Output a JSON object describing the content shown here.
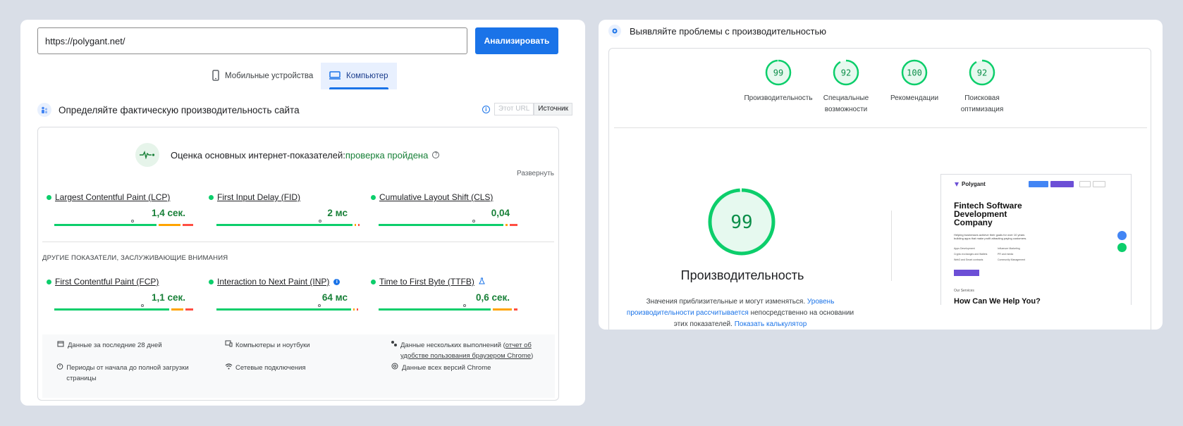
{
  "analyzer": {
    "url_value": "https://polygant.net/",
    "analyze_label": "Анализировать",
    "tabs": [
      {
        "label": "Мобильные устройства",
        "icon": "phone-icon"
      },
      {
        "label": "Компьютер",
        "icon": "monitor-icon"
      }
    ]
  },
  "field": {
    "title": "Определяйте фактическую производительность сайта",
    "source_options": [
      "Этот URL",
      "Источник"
    ],
    "assessment_label": "Оценка основных интернет-показателей:",
    "assessment_result": "проверка пройдена",
    "expand_label": "Развернуть",
    "core_metrics": [
      {
        "name": "Largest Contentful Paint (LCP)",
        "value": "1,4 сек.",
        "good": 0.74,
        "ni": 0.17,
        "poor": 0.09
      },
      {
        "name": "First Input Delay (FID)",
        "value": "2 мс",
        "good": 0.98,
        "ni": 0.01,
        "poor": 0.01
      },
      {
        "name": "Cumulative Layout Shift (CLS)",
        "value": "0,04",
        "good": 0.9,
        "ni": 0.03,
        "poor": 0.07
      }
    ],
    "other_title": "ДРУГИЕ ПОКАЗАТЕЛИ, ЗАСЛУЖИВАЮЩИЕ ВНИМАНИЯ",
    "other_metrics": [
      {
        "name": "First Contentful Paint (FCP)",
        "value": "1,1 сек.",
        "good": 0.83,
        "ni": 0.1,
        "poor": 0.07
      },
      {
        "name": "Interaction to Next Paint (INP)",
        "value": "64 мс",
        "good": 0.97,
        "ni": 0.02,
        "poor": 0.01
      },
      {
        "name": "Time to First Byte (TTFB)",
        "value": "0,6 сек.",
        "good": 0.81,
        "ni": 0.15,
        "poor": 0.04
      }
    ],
    "info": {
      "period": "Данные за последние 28 дней",
      "devices": "Компьютеры и ноутбуки",
      "runs_prefix": "Данные нескольких выполнений (",
      "runs_link": "отчет об удобстве пользования браузером Chrome",
      "runs_suffix": ")",
      "duration": "Периоды от начала до полной загрузки страницы",
      "network": "Сетевые подключения",
      "chrome": "Данные всех версий Chrome"
    }
  },
  "lab": {
    "title": "Выявляйте проблемы с производительностью",
    "scores": [
      {
        "value": "99",
        "score": 0.99,
        "label_lines": [
          "Производительность"
        ]
      },
      {
        "value": "92",
        "score": 0.92,
        "label_lines": [
          "Специальные",
          "возможности"
        ]
      },
      {
        "value": "100",
        "score": 1.0,
        "label_lines": [
          "Рекомендации"
        ]
      },
      {
        "value": "92",
        "score": 0.92,
        "label_lines": [
          "Поисковая",
          "оптимизация"
        ]
      }
    ],
    "big_score": "99",
    "big_label": "Производительность",
    "desc_part1": "Значения приблизительные и могут изменяться. ",
    "desc_link1": "Уровень производительности рассчитывается",
    "desc_part2": " непосредственно на основании этих показателей. ",
    "desc_link2": "Показать калькулятор",
    "preview": {
      "brand": "Polygant",
      "hero": "Fintech Software Development Company",
      "sub": "Helping businesses achieve their goals for over 10 years building apps that make profit attracting paying customers.",
      "list_left": [
        "Apps Development",
        "Crypto exchanges and Wallets",
        "Web3 and Smart contracts"
      ],
      "list_right": [
        "Influencer Marketing",
        "PR and media",
        "Community Management"
      ],
      "services": "Our Services",
      "help": "How Can We Help You?"
    }
  },
  "colors": {
    "good": "#0cce6b",
    "ni": "#ffa400",
    "poor": "#ff4e42",
    "accent": "#1a73e8"
  }
}
